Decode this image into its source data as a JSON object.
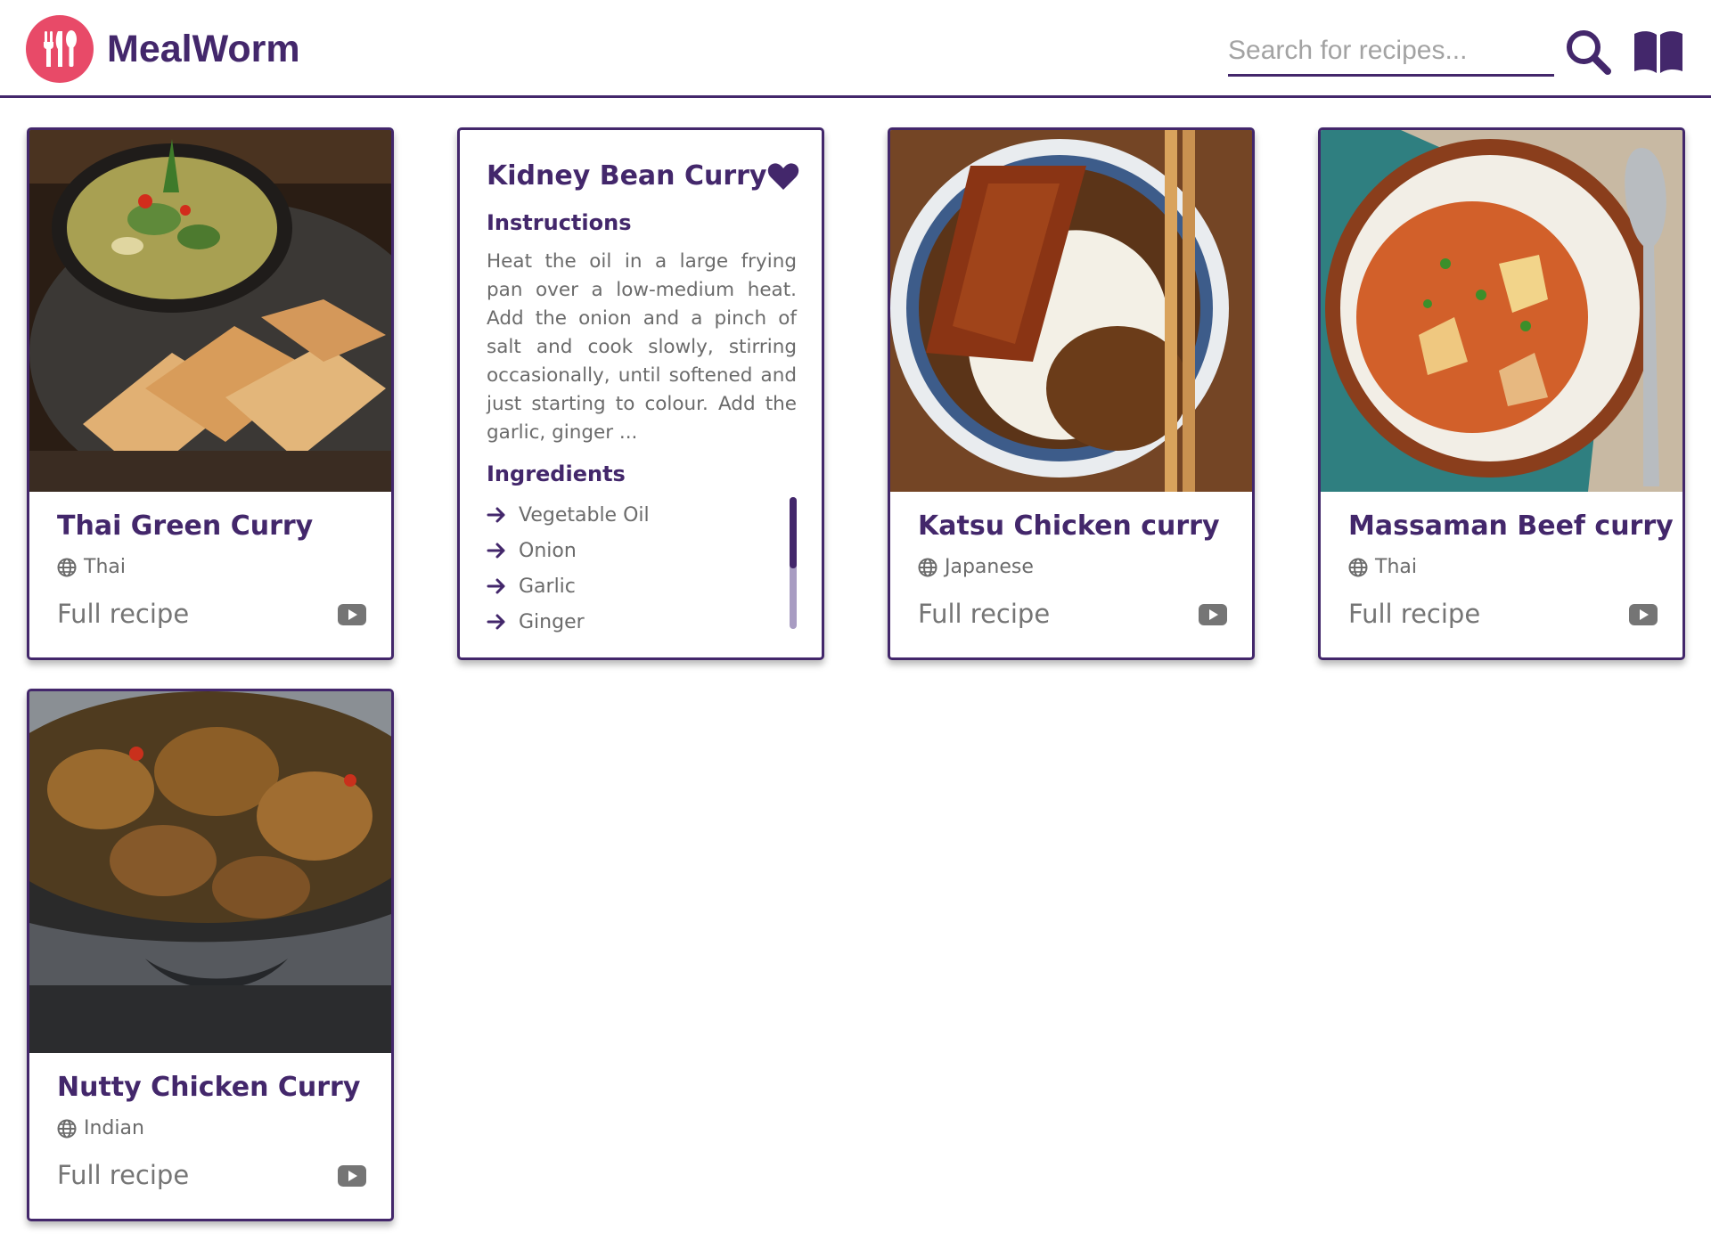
{
  "app": {
    "title": "MealWorm",
    "brand_color": "#43276b",
    "logo_color": "#e84a68",
    "logo_icon": "utensils-icon"
  },
  "search": {
    "placeholder": "Search for recipes...",
    "value": "",
    "button_icon": "search-icon"
  },
  "toolbar": {
    "book_icon": "book-open-icon"
  },
  "cards": [
    {
      "title": "Thai Green Curry",
      "cuisine": "Thai",
      "link_label": "Full recipe",
      "video_icon": "youtube-icon"
    },
    {
      "title": "Katsu Chicken curry",
      "cuisine": "Japanese",
      "link_label": "Full recipe",
      "video_icon": "youtube-icon"
    },
    {
      "title": "Massaman Beef curry",
      "cuisine": "Thai",
      "link_label": "Full recipe",
      "video_icon": "youtube-icon"
    },
    {
      "title": "Nutty Chicken Curry",
      "cuisine": "Indian",
      "link_label": "Full recipe",
      "video_icon": "youtube-icon"
    }
  ],
  "flipped_card": {
    "title": "Kidney Bean Curry",
    "favorite_icon": "heart-icon",
    "instructions_heading": "Instructions",
    "instructions": "Heat the oil in a large frying pan over a low-medium heat. Add the onion and a pinch of salt and cook slowly, stirring occasionally, until softened and just starting to colour. Add the garlic, ginger ...",
    "ingredients_heading": "Ingredients",
    "ingredients": [
      "Vegetable Oil",
      "Onion",
      "Garlic",
      "Ginger"
    ]
  }
}
